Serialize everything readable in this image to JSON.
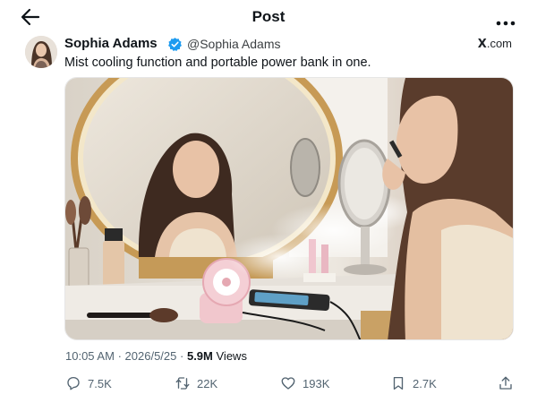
{
  "header": {
    "title": "Post",
    "back_icon": "arrow-left-icon",
    "more_icon": "more-horizontal-icon"
  },
  "post": {
    "author_name": "Sophia Adams",
    "verified_icon": "verified-badge-icon",
    "handle": "@Sophia Adams",
    "source_logo": "X",
    "source_suffix": ".com",
    "text": "Mist cooling function and portable power bank in one.",
    "media_description_icon": "photo-woman-mirror-mist-fan",
    "time": "10:05 AM",
    "separator": "·",
    "date": "2026/5/25",
    "views_count": "5.9M",
    "views_label": "Views"
  },
  "actions": {
    "reply": {
      "icon": "reply-icon",
      "count": "7.5K"
    },
    "retweet": {
      "icon": "retweet-icon",
      "count": "22K"
    },
    "like": {
      "icon": "heart-icon",
      "count": "193K"
    },
    "bookmark": {
      "icon": "bookmark-icon",
      "count": "2.7K"
    },
    "share": {
      "icon": "share-icon"
    }
  },
  "colors": {
    "text_primary": "#0f1419",
    "text_secondary": "#536471",
    "verified_blue": "#1d9bf0"
  }
}
